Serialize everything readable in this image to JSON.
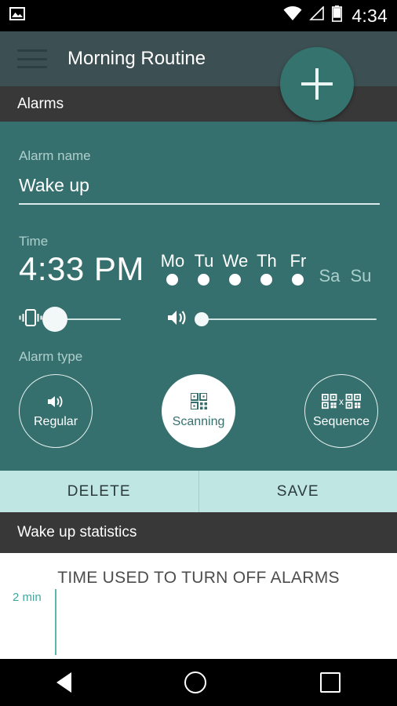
{
  "status_bar": {
    "clock": "4:34",
    "icons": [
      "image-icon",
      "wifi-icon",
      "cell-signal-icon",
      "battery-icon"
    ]
  },
  "app_bar": {
    "title": "Morning Routine",
    "menu_icon": "hamburger-menu-icon",
    "fab_label": "+"
  },
  "tab_bar": {
    "label": "Alarms"
  },
  "form": {
    "alarm_name_label": "Alarm name",
    "alarm_name_value": "Wake up",
    "alarm_name_placeholder": "Alarm name",
    "time_label": "Time",
    "time_value": "4:33 PM",
    "days": [
      {
        "name": "Mo",
        "selected": true
      },
      {
        "name": "Tu",
        "selected": true
      },
      {
        "name": "We",
        "selected": true
      },
      {
        "name": "Th",
        "selected": true
      },
      {
        "name": "Fr",
        "selected": true
      },
      {
        "name": "Sa",
        "selected": false
      },
      {
        "name": "Su",
        "selected": false
      }
    ],
    "vibration_slider": {
      "icon": "vibration-icon",
      "value": 8
    },
    "volume_slider": {
      "icon": "volume-icon",
      "value": 3
    },
    "alarm_type_label": "Alarm type",
    "alarm_types": [
      {
        "label": "Regular",
        "icon": "volume-icon",
        "selected": false
      },
      {
        "label": "Scanning",
        "icon": "qr-code-icon",
        "selected": true
      },
      {
        "label": "Sequence",
        "icon": "qr-code-sequence-icon",
        "selected": false
      }
    ]
  },
  "actions": {
    "delete_label": "DELETE",
    "save_label": "SAVE"
  },
  "statistics": {
    "header": "Wake up statistics"
  },
  "chart_data": {
    "type": "bar",
    "title": "TIME USED TO TURN OFF ALARMS",
    "categories": [],
    "values": [],
    "ytick_labels": [
      "2 min"
    ],
    "ylabel": "",
    "xlabel": "",
    "ylim": [
      0,
      2
    ],
    "grid": false,
    "legend": "none",
    "axis_color": "#5bb7ad",
    "note": "empty plot area, only y-axis line and 2 min tick visible"
  },
  "nav_bar": {
    "back": "back-triangle-icon",
    "home": "home-circle-icon",
    "recents": "recents-square-icon"
  },
  "colors": {
    "teal": "#36706E",
    "app_bar": "#3C4F52",
    "dark_gray": "#383838",
    "mint": "#BFE6E2",
    "accent": "#5BB7AD"
  }
}
